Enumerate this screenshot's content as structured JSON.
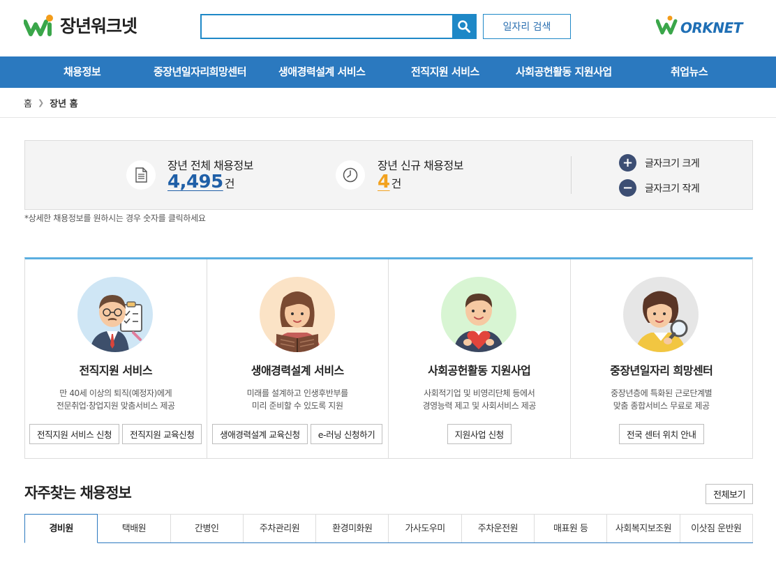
{
  "header": {
    "site_name": "장년워크넷",
    "search": {
      "value": "",
      "placeholder": ""
    },
    "job_search_label": "일자리 검색",
    "worknet_logo_text": "ORKNET"
  },
  "nav": {
    "items": [
      "채용정보",
      "중장년일자리희망센터",
      "생애경력설계 서비스",
      "전직지원 서비스",
      "사회공헌활동 지원사업",
      "취업뉴스"
    ]
  },
  "breadcrumb": {
    "home": "홈",
    "current": "장년 홈"
  },
  "stats": {
    "total": {
      "label": "장년 전체 채용정보",
      "value": "4,495",
      "unit": "건",
      "color": "#1f5fa7"
    },
    "new": {
      "label": "장년 신규 채용정보",
      "value": "4",
      "unit": "건",
      "color": "#f2a21f"
    },
    "font_larger": "글자크기 크게",
    "font_smaller": "글자크기 작게",
    "note": "*상세한 채용정보를 원하시는 경우 숫자를 클릭하세요"
  },
  "cards": [
    {
      "title": "전직지원 서비스",
      "desc": [
        "만 40세 이상의 퇴직(예정자)에게",
        "전문취업·창업지원 맞춤서비스 제공"
      ],
      "buttons": [
        "전직지원 서비스 신청",
        "전직지원 교육신청"
      ],
      "bg_color": "#cfe6f5"
    },
    {
      "title": "생애경력설계 서비스",
      "desc": [
        "미래를 설계하고 인생후반부를",
        "미리 준비할 수 있도록 지원"
      ],
      "buttons": [
        "생애경력설계 교육신청",
        "e-러닝 신청하기"
      ],
      "bg_color": "#fbe3c6"
    },
    {
      "title": "사회공헌활동 지원사업",
      "desc": [
        "사회적기업 및 비영리단체 등에서",
        "경영능력 제고 및 사회서비스 제공"
      ],
      "buttons": [
        "지원사업 신청"
      ],
      "bg_color": "#d8f5d3"
    },
    {
      "title": "중장년일자리 희망센터",
      "desc": [
        "중장년층에 특화된 근로단계별",
        "맞춤 종합서비스 무료로 제공"
      ],
      "buttons": [
        "전국 센터 위치 안내"
      ],
      "bg_color": "#e6e6e6"
    }
  ],
  "frequent": {
    "title": "자주찾는 채용정보",
    "view_all": "전체보기",
    "tabs": [
      "경비원",
      "택배원",
      "간병인",
      "주차관리원",
      "환경미화원",
      "가사도우미",
      "주차운전원",
      "매표원 등",
      "사회복지보조원",
      "이삿짐 운반원"
    ],
    "active_tab": "경비원"
  },
  "colors": {
    "primary": "#2b79bf",
    "accent_blue": "#1e88c7",
    "logo_green": "#3aa64a",
    "logo_orange": "#f39c1a"
  }
}
